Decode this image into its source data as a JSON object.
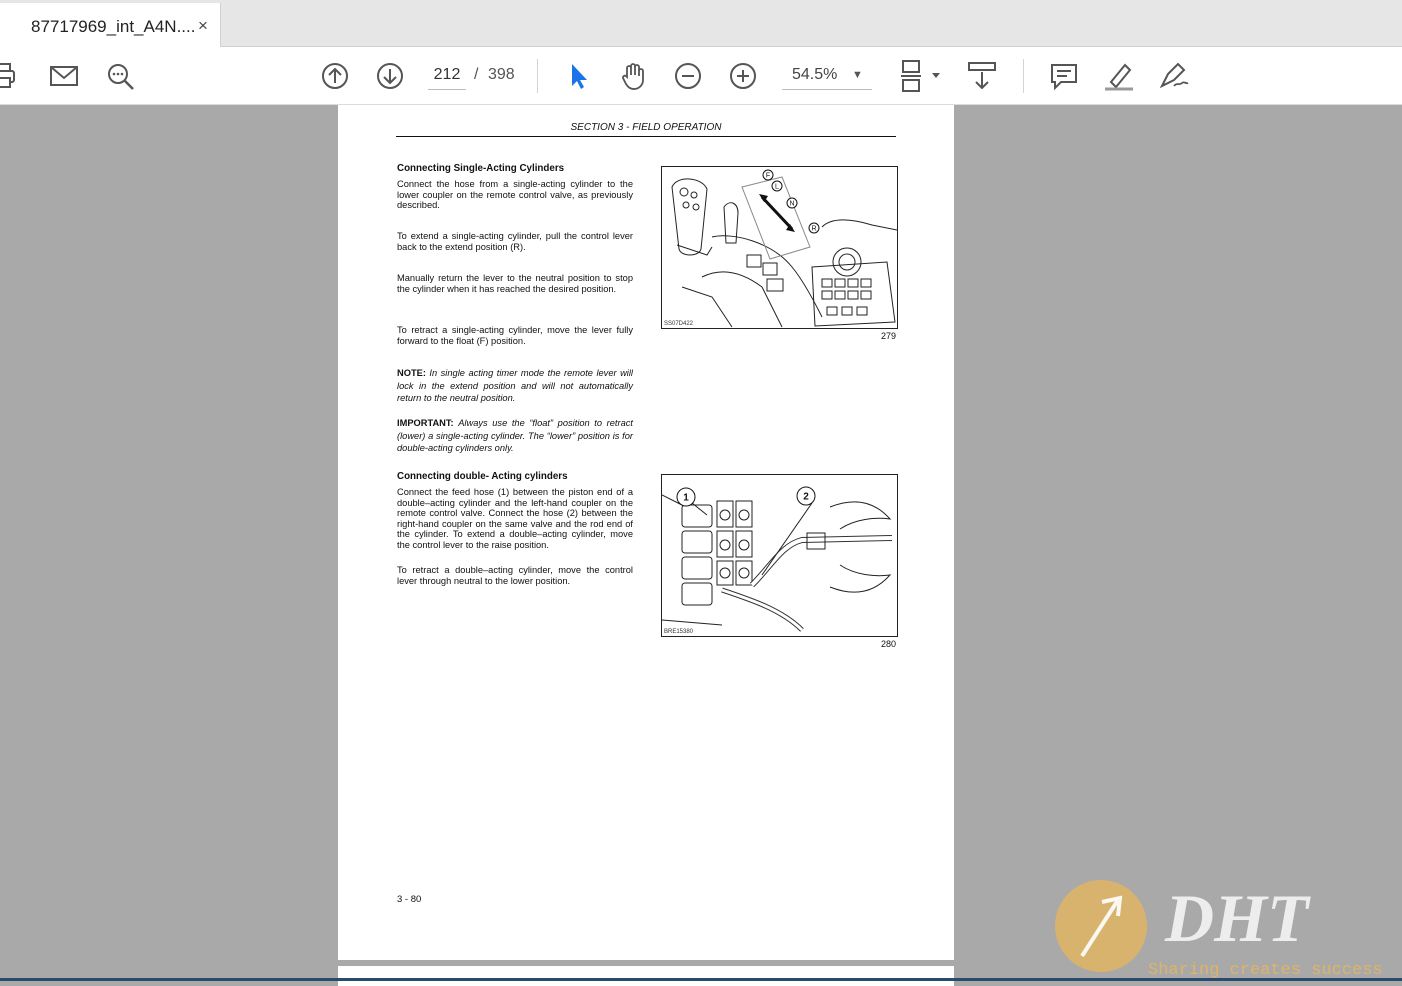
{
  "tab": {
    "title": "87717969_int_A4N....",
    "close": "×"
  },
  "toolbar": {
    "page_current": "212",
    "page_separator": "/",
    "page_total": "398",
    "zoom": "54.5%",
    "icons": [
      "print-icon",
      "email-icon",
      "search-zoom-icon",
      "page-up-icon",
      "page-down-icon",
      "select-cursor-icon",
      "hand-icon",
      "zoom-out-icon",
      "zoom-in-icon",
      "page-fit-icon",
      "scroll-mode-icon",
      "comment-icon",
      "highlight-icon",
      "sign-icon"
    ],
    "accent": "#1a73e8"
  },
  "doc": {
    "header": "SECTION 3 - FIELD OPERATION",
    "s1_title": "Connecting Single-Acting Cylinders",
    "p1": "Connect the hose from a single-acting cylinder to the lower coupler on the remote control valve, as previously described.",
    "p2": "To extend a single-acting cylinder, pull the control lever back to the extend position (R).",
    "p3": "Manually return the lever to the neutral position to stop the cylinder when it has reached the desired position.",
    "p4": "To retract a single-acting cylinder, move the lever fully forward to the float (F) position.",
    "note_label": "NOTE:",
    "note_text": "In single acting timer mode the remote lever will lock in the extend position and will not automatically return to the neutral position.",
    "important_label": "IMPORTANT:",
    "important_text": "Always use the “float” position to retract (lower) a single-acting cylinder. The “lower” position is for double-acting cylinders only.",
    "s2_title": "Connecting double- Acting cylinders",
    "p5": "Connect the feed hose (1) between the piston end of a double–acting cylinder and the left-hand coupler on the remote control valve. Connect the hose (2) between the right-hand coupler on the same valve and the rod end of the cylinder. To extend a double–acting cylinder, move the control lever to the raise position.",
    "p6": "To retract a double–acting cylinder, move the control lever through neutral to the lower position.",
    "fig1_number": "279",
    "fig1_code": "SS07D422",
    "fig1_labels": [
      "F",
      "L",
      "N",
      "R"
    ],
    "fig2_number": "280",
    "fig2_code": "BRE15380",
    "fig2_labels": [
      "1",
      "2"
    ],
    "page_number": "3 - 80"
  },
  "watermark": {
    "brand": "DHT",
    "tagline": "Sharing creates success"
  }
}
